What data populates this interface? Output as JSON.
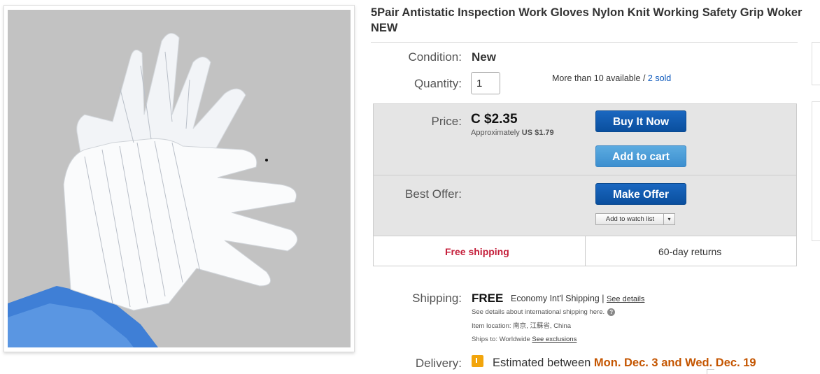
{
  "listing": {
    "title": "5Pair Antistatic Inspection Work Gloves Nylon Knit Working Safety Grip Woker NEW",
    "image_alt": "white antistatic striped gloves"
  },
  "condition": {
    "label": "Condition:",
    "value": "New"
  },
  "quantity": {
    "label": "Quantity:",
    "value": "1",
    "available_text": "More than 10 available / ",
    "sold_link": "2 sold"
  },
  "price": {
    "label": "Price:",
    "value": "C $2.35",
    "approx_prefix": "Approximately ",
    "approx_value": "US $1.79"
  },
  "buttons": {
    "buy_it_now": "Buy It Now",
    "add_to_cart": "Add to cart",
    "make_offer": "Make Offer",
    "add_to_watch_list": "Add to watch list",
    "watch_dropdown_glyph": "▾"
  },
  "best_offer": {
    "label": "Best Offer:"
  },
  "badges": {
    "free_shipping": "Free shipping",
    "returns": "60-day returns"
  },
  "shipping": {
    "label": "Shipping:",
    "free": "FREE",
    "method": "Economy Int'l Shipping | ",
    "see_details": "See details",
    "intl_note": "See details about international shipping here.",
    "help_glyph": "?",
    "item_location": "Item location:  南京, 江蘇省, China",
    "ships_to": "Ships to:  Worldwide  ",
    "see_exclusions": "See exclusions"
  },
  "delivery": {
    "label": "Delivery:",
    "prefix": "Estimated between ",
    "range": "Mon. Dec. 3 and Wed. Dec. 19"
  },
  "colors": {
    "buy_button": "#0a57ad",
    "cart_button": "#4a9ad6",
    "free_shipping": "#c41e3a",
    "delivery_highlight": "#c45500",
    "link": "#0654ba"
  },
  "icons": {
    "help": "help-circle-icon",
    "delivery": "delivery-flag-icon",
    "dropdown": "chevron-down-icon"
  }
}
